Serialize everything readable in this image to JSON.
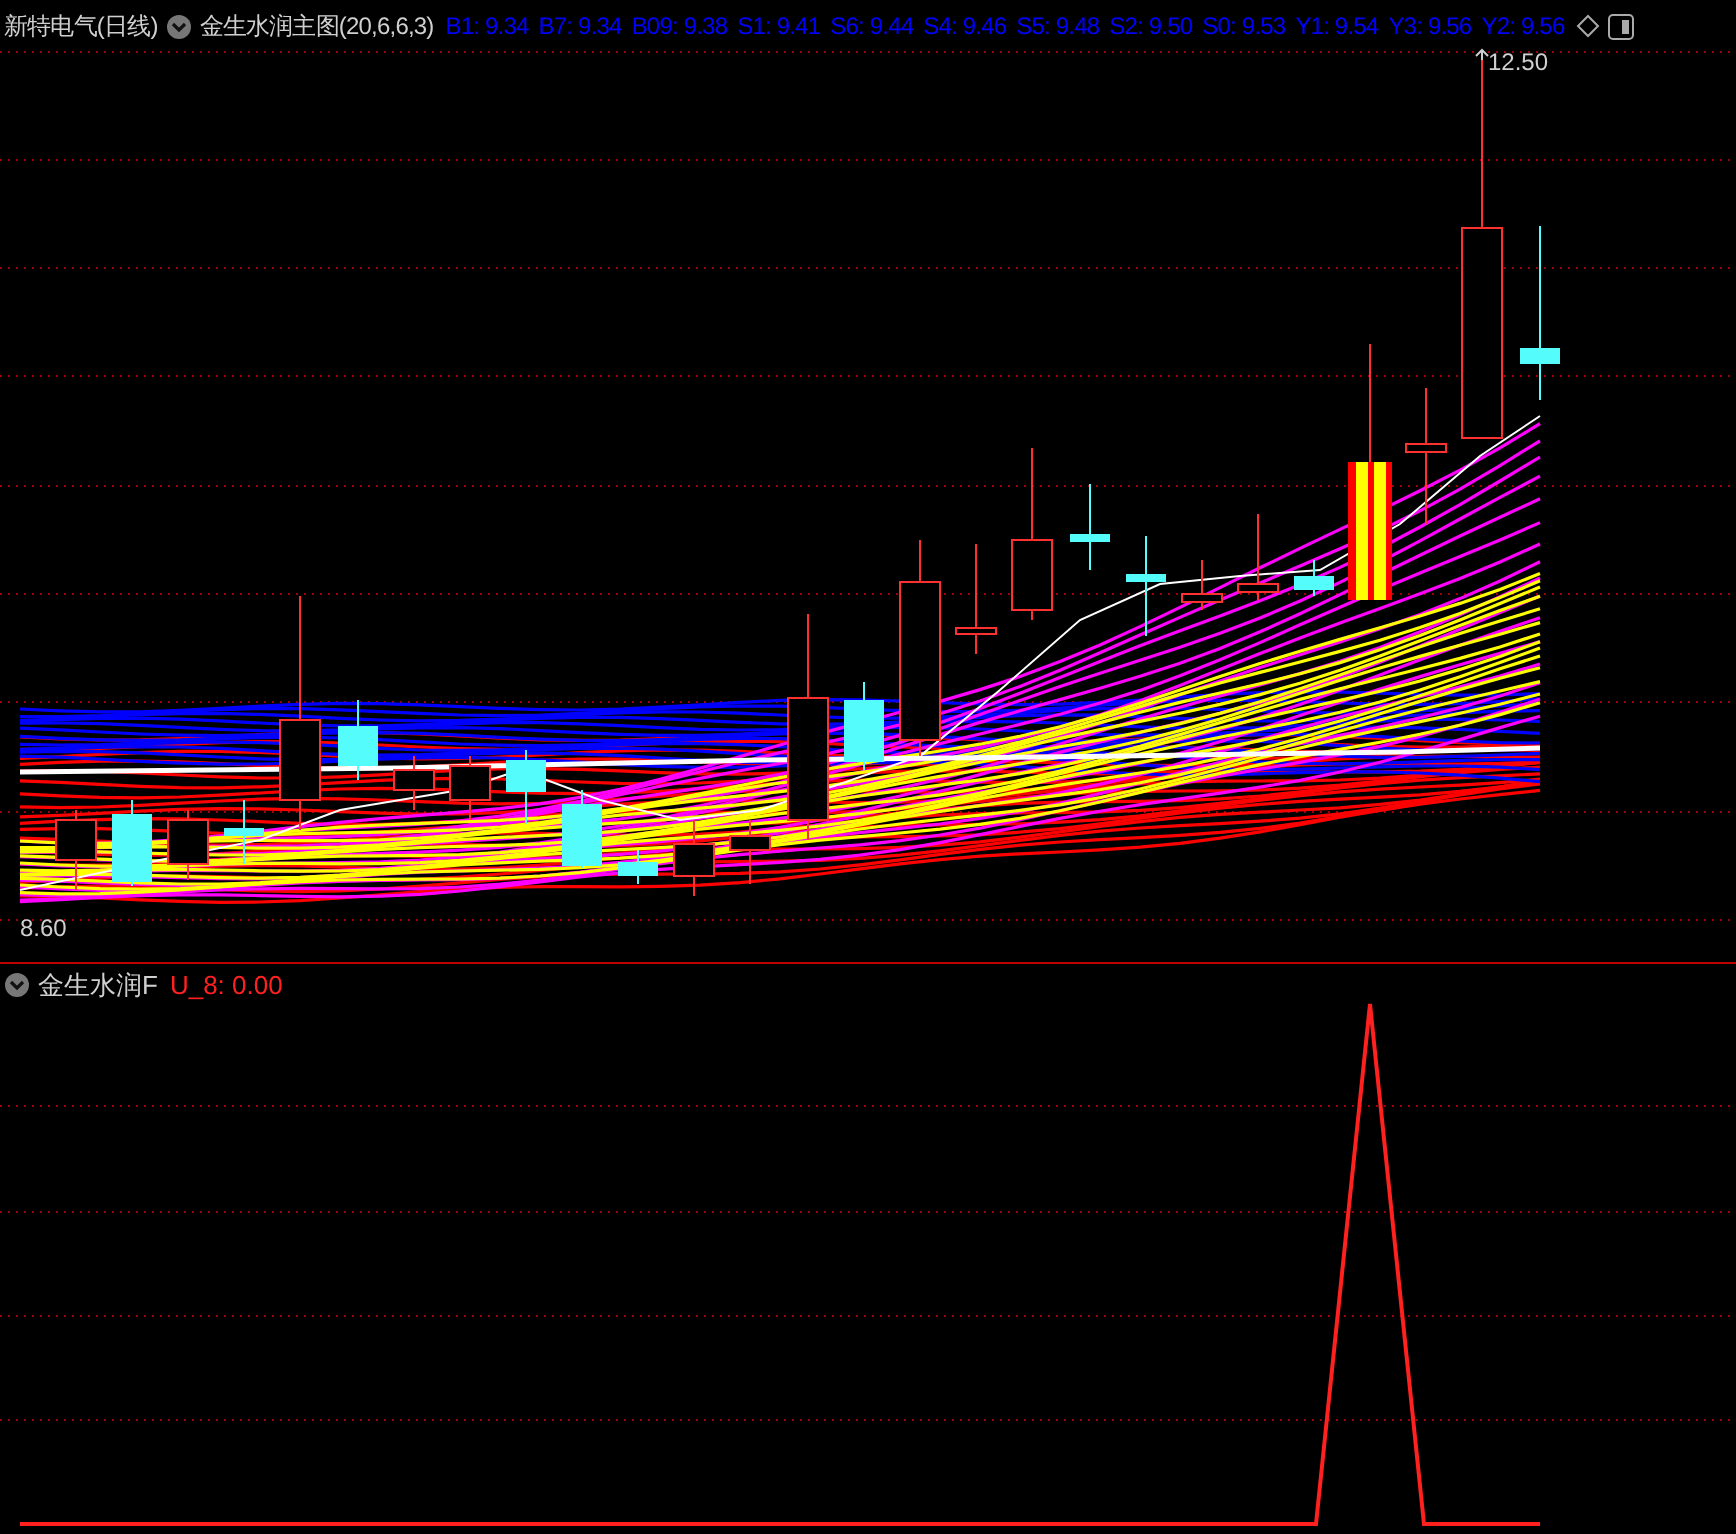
{
  "main_panel": {
    "stock": "新特电气(日线)",
    "indicator": "金生水润主图",
    "params": "(20,6,6,3)",
    "legend": [
      {
        "label": "B1: 9.34",
        "color": "#0000ff"
      },
      {
        "label": "B7: 9.34",
        "color": "#0000ff"
      },
      {
        "label": "B09: 9.38",
        "color": "#0000ff"
      },
      {
        "label": "S1: 9.41",
        "color": "#0000ff"
      },
      {
        "label": "S6: 9.44",
        "color": "#0000ff"
      },
      {
        "label": "S4: 9.46",
        "color": "#0000ff"
      },
      {
        "label": "S5: 9.48",
        "color": "#0000ff"
      },
      {
        "label": "S2: 9.50",
        "color": "#0000ff"
      },
      {
        "label": "S0: 9.53",
        "color": "#0000ff"
      },
      {
        "label": "Y1: 9.54",
        "color": "#0000ff"
      },
      {
        "label": "Y3: 9.56",
        "color": "#0000ff"
      },
      {
        "label": "Y2: 9.56",
        "color": "#0000ff"
      }
    ],
    "high_label": "12.50",
    "low_label": "8.60"
  },
  "sub_panel": {
    "indicator": "金生水润F",
    "reading": "U_8: 0.00"
  }
}
